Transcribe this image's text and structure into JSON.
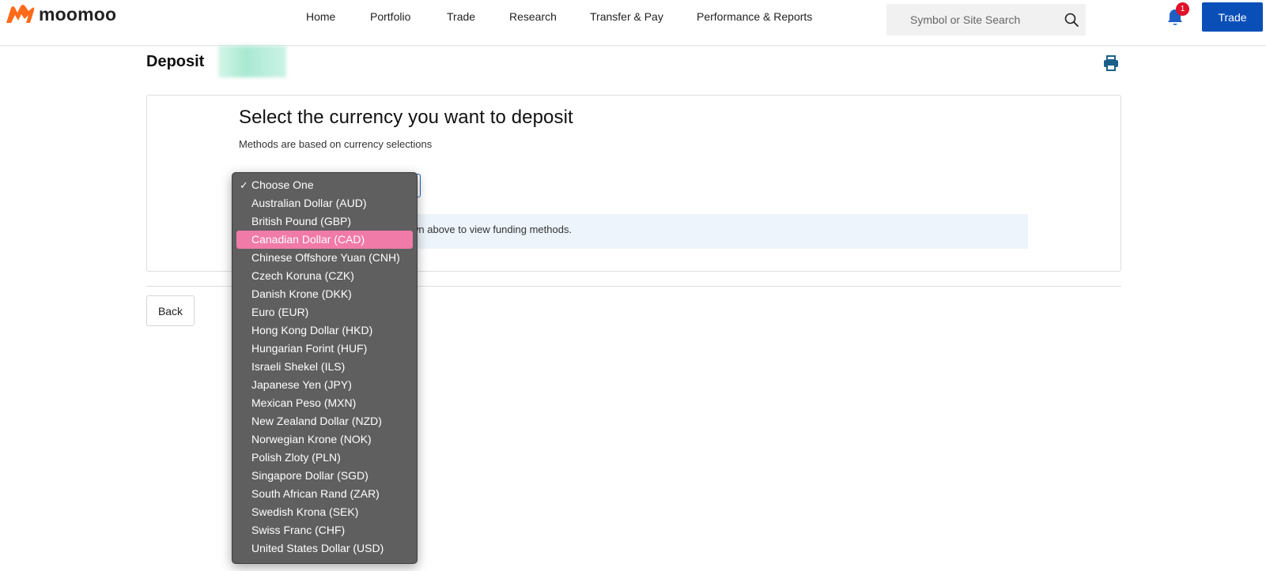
{
  "header": {
    "logo_text": "moomoo",
    "nav": [
      "Home",
      "Portfolio",
      "Trade",
      "Research",
      "Transfer & Pay",
      "Performance & Reports"
    ],
    "search_placeholder": "Symbol or Site Search",
    "notification_count": "1",
    "trade_button": "Trade"
  },
  "page": {
    "title": "Deposit",
    "card_title": "Select the currency you want to deposit",
    "card_subtitle": "Methods are based on currency selections",
    "info_text": "wn above to view funding methods.",
    "back_button": "Back"
  },
  "dropdown": {
    "checked_index": 0,
    "highlighted_index": 3,
    "options": [
      "Choose One",
      "Australian Dollar (AUD)",
      "British Pound (GBP)",
      "Canadian Dollar (CAD)",
      "Chinese Offshore Yuan (CNH)",
      "Czech Koruna (CZK)",
      "Danish Krone (DKK)",
      "Euro (EUR)",
      "Hong Kong Dollar (HKD)",
      "Hungarian Forint (HUF)",
      "Israeli Shekel (ILS)",
      "Japanese Yen (JPY)",
      "Mexican Peso (MXN)",
      "New Zealand Dollar (NZD)",
      "Norwegian Krone (NOK)",
      "Polish Zloty (PLN)",
      "Singapore Dollar (SGD)",
      "South African Rand (ZAR)",
      "Swedish Krona (SEK)",
      "Swiss Franc (CHF)",
      "United States Dollar (USD)"
    ]
  },
  "colors": {
    "brand_orange": "#ff6a1a",
    "primary_blue": "#0a4fb8",
    "highlight_pink": "#f07aa8",
    "badge_red": "#e0112b"
  },
  "icons": [
    "moomoo-logo-icon",
    "search-icon",
    "bell-icon",
    "print-icon",
    "checkmark-icon"
  ]
}
